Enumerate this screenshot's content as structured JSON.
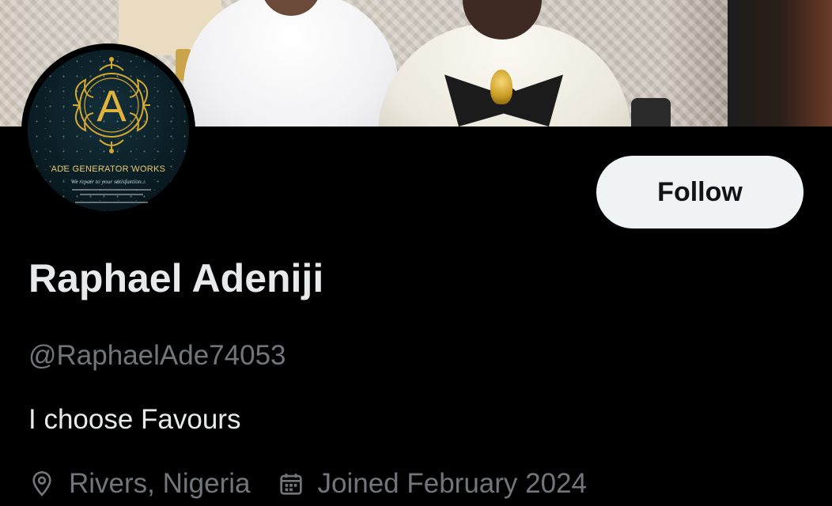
{
  "profile": {
    "display_name": "Raphael Adeniji",
    "handle": "@RaphaelAde74053",
    "bio": "I choose Favours",
    "location": "Rivers, Nigeria",
    "joined": "Joined February 2024",
    "follow_label": "Follow",
    "avatar": {
      "emblem_letter": "A",
      "brand_text": "ADE GENERATOR WORKS",
      "tagline": "We repair to your satisfaction..."
    }
  },
  "icons": {
    "location": "location-pin-icon",
    "joined": "calendar-icon"
  },
  "colors": {
    "background": "#000000",
    "primary_text": "#e7e9ea",
    "secondary_text": "#71767b",
    "follow_button_bg": "#eff3f4",
    "follow_button_text": "#0f1419",
    "emblem_gold": "#d4a933"
  }
}
